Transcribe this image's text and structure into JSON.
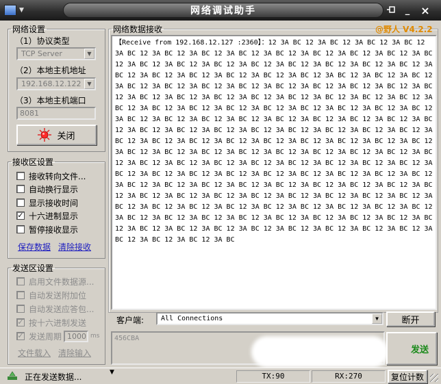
{
  "window": {
    "title": "网络调试助手",
    "pin_icon": "pin-icon",
    "minimize_label": "_",
    "close_label": "×"
  },
  "network": {
    "group_title": "网络设置",
    "protocol_label": "（1）协议类型",
    "protocol_value": "TCP Server",
    "host_label": "（2）本地主机地址",
    "host_value": "192.168.12.122",
    "port_label": "（3）本地主机端口",
    "port_value": "8081",
    "toggle_label": "关闭"
  },
  "receive_settings": {
    "group_title": "接收区设置",
    "options": [
      {
        "label": "接收转向文件...",
        "checked": false
      },
      {
        "label": "自动换行显示",
        "checked": false
      },
      {
        "label": "显示接收时间",
        "checked": false
      },
      {
        "label": "十六进制显示",
        "checked": true
      },
      {
        "label": "暂停接收显示",
        "checked": false
      }
    ],
    "save_link": "保存数据",
    "clear_link": "清除接收"
  },
  "send_settings": {
    "group_title": "发送区设置",
    "options": [
      {
        "label": "启用文件数据源...",
        "checked": false
      },
      {
        "label": "自动发送附加位",
        "checked": false
      },
      {
        "label": "自动发送应答包...",
        "checked": false
      },
      {
        "label": "按十六进制发送",
        "checked": true
      }
    ],
    "period_label": "发送周期",
    "period_value": "1000",
    "period_unit": "ms",
    "period_checked": true,
    "load_link": "文件载入",
    "clear_link": "清除输入"
  },
  "receive_area": {
    "title": "网络数据接收",
    "version": "@野人 V4.2.2",
    "content": "【Receive from 192.168.12.127 :2360】：12 3A BC 12 3A BC 12 3A BC 12 3A BC 12 3A BC 12 3A BC 12 3A BC 12 3A BC 12 3A BC 12 3A BC 12 3A BC 12 3A BC 12 3A BC 12 3A BC 12 3A BC 12 3A BC 12 3A BC 12 3A BC 12 3A BC 12 3A BC 12 3A BC 12 3A BC 12 3A BC 12 3A BC 12 3A BC 12 3A BC 12 3A BC 12 3A BC 12 3A BC 12 3A BC 12 3A BC 12 3A BC 12 3A BC 12 3A BC 12 3A BC 12 3A BC 12 3A BC 12 3A BC 12 3A BC 12 3A BC 12 3A BC 12 3A BC 12 3A BC 12 3A BC 12 3A BC 12 3A BC 12 3A BC 12 3A BC 12 3A BC 12 3A BC 12 3A BC 12 3A BC 12 3A BC 12 3A BC 12 3A BC 12 3A BC 12 3A BC 12 3A BC 12 3A BC 12 3A BC 12 3A BC 12 3A BC 12 3A BC 12 3A BC 12 3A BC 12 3A BC 12 3A BC 12 3A BC 12 3A BC 12 3A BC 12 3A BC 12 3A BC 12 3A BC 12 3A BC 12 3A BC 12 3A BC 12 3A BC 12 3A BC 12 3A BC 12 3A BC 12 3A BC 12 3A BC 12 3A BC 12 3A BC 12 3A BC 12 3A BC 12 3A BC 12 3A BC 12 3A BC 12 3A BC 12 3A BC 12 3A BC 12 3A BC 12 3A BC 12 3A BC 12 3A BC 12 3A BC 12 3A BC 12 3A BC 12 3A BC 12 3A BC 12 3A BC 12 3A BC 12 3A BC 12 3A BC 12 3A BC 12 3A BC 12 3A BC 12 3A BC 12 3A BC 12 3A BC 12 3A BC 12 3A BC 12 3A BC 12 3A BC 12 3A BC 12 3A BC 12 3A BC 12 3A BC 12 3A BC 12 3A BC 12 3A BC 12 3A BC 12 3A BC 12 3A BC 12 3A BC 12 3A BC 12 3A BC 12 3A BC 12 3A BC 12 3A BC 12 3A BC 12 3A BC 12 3A BC 12 3A BC 12 3A BC 12 3A BC 12 3A BC 12 3A BC 12 3A BC 12 3A BC 12 3A BC 12 3A BC 12 3A BC 12 3A BC 12 3A BC 12 3A BC 12 3A BC 12 3A BC 12 3A BC 12 3A BC 12 3A BC 12 3A BC 12 3A BC 12 3A BC"
  },
  "client": {
    "label": "客户端:",
    "value": "All Connections",
    "disconnect_label": "断开"
  },
  "send_area": {
    "content": "456CBA",
    "send_label": "发送"
  },
  "status": {
    "message": "正在发送数据...",
    "tx": "TX:90",
    "rx": "RX:270",
    "reset_label": "复位计数"
  },
  "colors": {
    "version": "#e08a00",
    "link": "#2020c0"
  }
}
